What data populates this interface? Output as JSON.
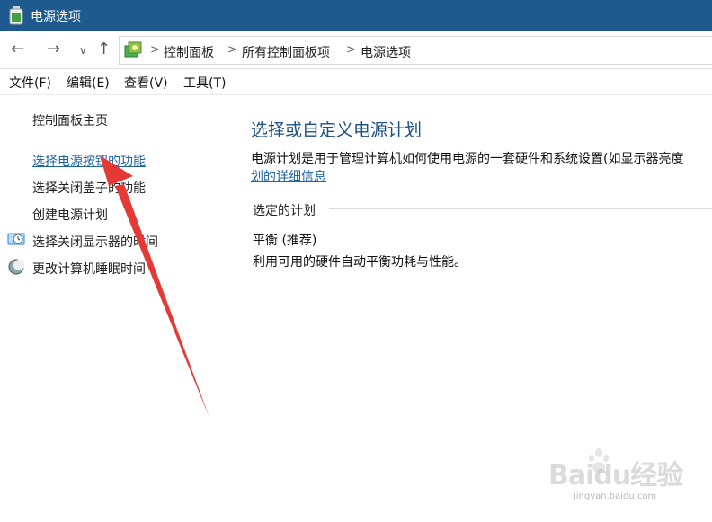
{
  "window": {
    "title": "电源选项"
  },
  "address": {
    "crumbs": [
      "控制面板",
      "所有控制面板项",
      "电源选项"
    ],
    "separator": ">"
  },
  "nav_glyphs": {
    "back": "←",
    "forward": "→",
    "recent": "∨",
    "up": "↑"
  },
  "menu": {
    "items": [
      "文件(F)",
      "编辑(E)",
      "查看(V)",
      "工具(T)"
    ]
  },
  "sidebar": {
    "items": [
      {
        "label": "控制面板主页",
        "icon": ""
      },
      {
        "label": "选择电源按钮的功能",
        "icon": "",
        "active": true
      },
      {
        "label": "选择关闭盖子的功能",
        "icon": ""
      },
      {
        "label": "创建电源计划",
        "icon": ""
      },
      {
        "label": "选择关闭显示器的时间",
        "icon": "monitor-clock-icon"
      },
      {
        "label": "更改计算机睡眠时间",
        "icon": "moon-sleep-icon"
      }
    ]
  },
  "main": {
    "title": "选择或自定义电源计划",
    "description": "电源计划是用于管理计算机如何使用电源的一套硬件和系统设置(如显示器亮度",
    "description_link": "划的详细信息",
    "section_label": "选定的计划",
    "plan_name": "平衡 (推荐)",
    "plan_description": "利用可用的硬件自动平衡功耗与性能。"
  },
  "watermark": {
    "text": "Baidu经验",
    "url": "jingyan.baidu.com"
  },
  "colors": {
    "titlebar": "#1e5a8e",
    "link": "#1c64a5",
    "heading": "#1e4f86",
    "arrow": "#e53935"
  }
}
